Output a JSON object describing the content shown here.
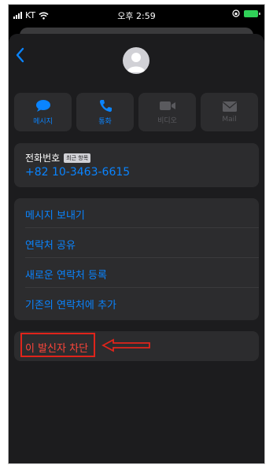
{
  "status_bar": {
    "carrier": "KT",
    "time": "오후 2:59"
  },
  "contact": {
    "actions": [
      {
        "label": "메시지",
        "icon": "message-icon",
        "state": "active"
      },
      {
        "label": "통화",
        "icon": "phone-icon",
        "state": "active"
      },
      {
        "label": "비디오",
        "icon": "video-icon",
        "state": "disabled"
      },
      {
        "label": "Mail",
        "icon": "mail-icon",
        "state": "disabled"
      }
    ],
    "phone": {
      "label": "전화번호",
      "tag": "최근 항목",
      "number": "+82 10-3463-6615"
    },
    "menu": [
      {
        "label": "메시지 보내기"
      },
      {
        "label": "연락처 공유"
      },
      {
        "label": "새로운 연락처 등록"
      },
      {
        "label": "기존의 연락처에 추가"
      }
    ],
    "block_label": "이 발신자 차단"
  },
  "colors": {
    "accent": "#0a84ff",
    "destructive": "#ff453a",
    "annotation": "#e0241b",
    "background": "#1c1c1e",
    "card": "#2c2c2e"
  }
}
